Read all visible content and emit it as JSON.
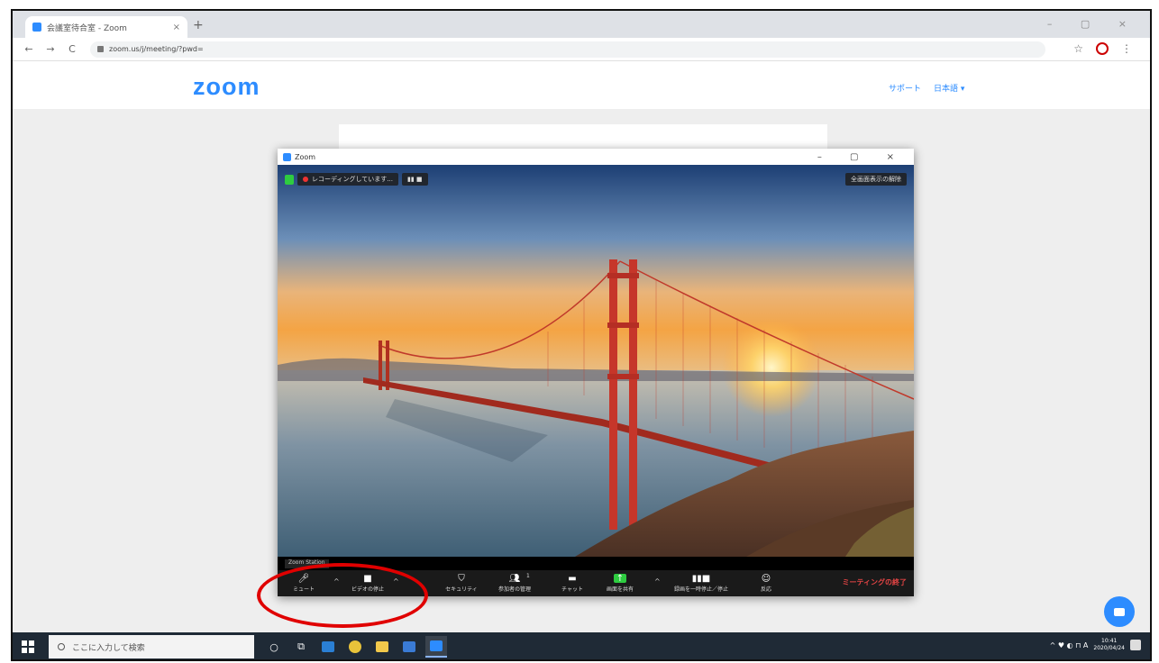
{
  "browser": {
    "tab_title": "会議室待合室 - Zoom",
    "tab_close": "×",
    "new_tab": "+",
    "window_controls": "– ▢ ×",
    "back": "←",
    "forward": "→",
    "reload": "C",
    "url": "zoom.us/j/meeting/?pwd=",
    "bookmark": "☆",
    "menu": "⋮"
  },
  "zoom_page": {
    "logo": "zoom",
    "support_link": "サポート",
    "language_link": "日本語 ▾"
  },
  "meeting_window": {
    "title": "Zoom",
    "controls": "– ▢ ×",
    "recording_label": "レコーディングしています...",
    "recording_controls": "▮▮ ■",
    "fullscreen_label": "全画面表示の解除",
    "participant_name": "Zoom Station",
    "toolbar": {
      "mute": "ミュート",
      "video_stop": "ビデオの停止",
      "security": "セキュリティ",
      "participants": "参加者の管理",
      "participants_count": "1",
      "chat": "チャット",
      "share_screen": "画面を共有",
      "pause_record": "録画を一時停止／停止",
      "reactions": "反応",
      "end_meeting": "ミーティングの終了"
    }
  },
  "taskbar": {
    "search_placeholder": "ここに入力して検索",
    "clock_time": "10:41",
    "clock_date": "2020/04/24",
    "ime": "A",
    "tray": "^ ♥ ◐ ⊓ A"
  },
  "colors": {
    "zoom_blue": "#2d8cff",
    "annotation_red": "#e00000",
    "end_red": "#e34444"
  }
}
